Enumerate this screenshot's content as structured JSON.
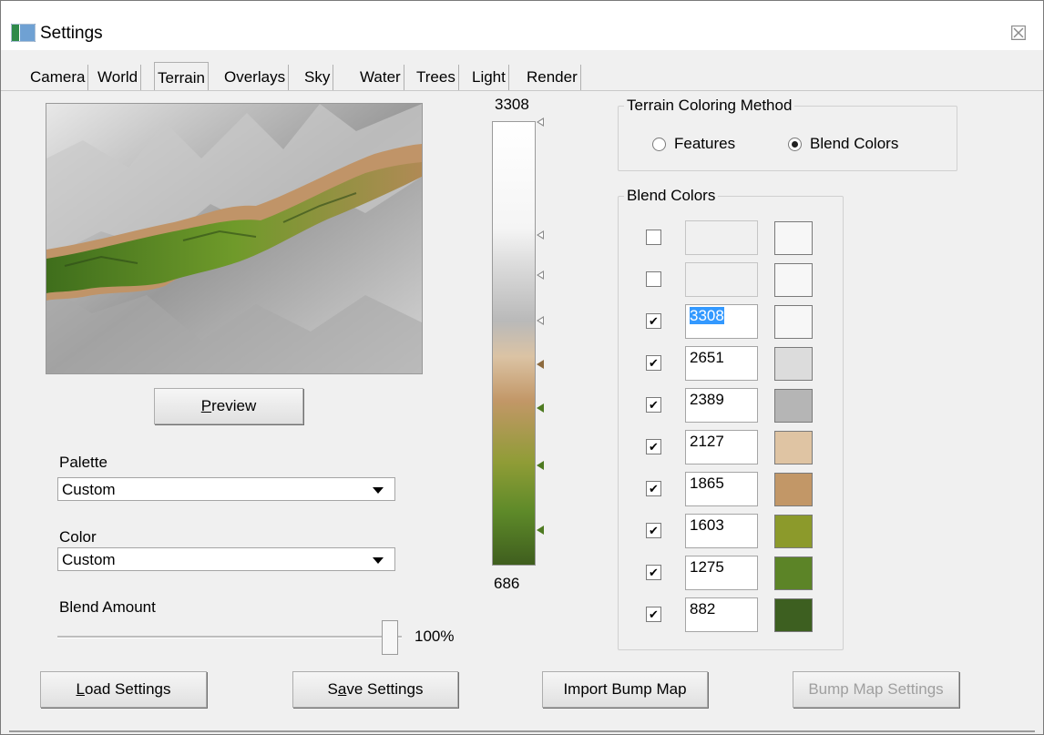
{
  "window": {
    "title": "Settings",
    "close_glyph": "☒"
  },
  "tabs": [
    {
      "label": "Camera"
    },
    {
      "label": "World"
    },
    {
      "label": "Terrain"
    },
    {
      "label": "Overlays"
    },
    {
      "label": "Sky"
    },
    {
      "label": "Water"
    },
    {
      "label": "Trees"
    },
    {
      "label": "Light"
    },
    {
      "label": "Render"
    }
  ],
  "active_tab": "Terrain",
  "preview": {
    "button_label": "Preview",
    "button_mnemonic": "P",
    "button_rest": "review"
  },
  "palette": {
    "label": "Palette",
    "value": "Custom"
  },
  "color": {
    "label": "Color",
    "value": "Custom"
  },
  "blend_amount": {
    "label": "Blend Amount",
    "value_text": "100%",
    "value": 100
  },
  "gradient": {
    "max": "3308",
    "min": "686"
  },
  "coloring_method": {
    "title": "Terrain Coloring Method",
    "options": [
      {
        "label": "Features",
        "checked": false
      },
      {
        "label": "Blend Colors",
        "checked": true
      }
    ]
  },
  "blend_colors": {
    "title": "Blend Colors",
    "rows": [
      {
        "checked": false,
        "value": "",
        "enabled": false,
        "color": "#f7f7f7"
      },
      {
        "checked": false,
        "value": "",
        "enabled": false,
        "color": "#f7f7f7"
      },
      {
        "checked": true,
        "value": "3308",
        "enabled": true,
        "selected": true,
        "color": "#f7f7f7"
      },
      {
        "checked": true,
        "value": "2651",
        "enabled": true,
        "color": "#dcdcdc"
      },
      {
        "checked": true,
        "value": "2389",
        "enabled": true,
        "color": "#b5b5b5"
      },
      {
        "checked": true,
        "value": "2127",
        "enabled": true,
        "color": "#dfc4a3"
      },
      {
        "checked": true,
        "value": "1865",
        "enabled": true,
        "color": "#c29767"
      },
      {
        "checked": true,
        "value": "1603",
        "enabled": true,
        "color": "#8c9a2b"
      },
      {
        "checked": true,
        "value": "1275",
        "enabled": true,
        "color": "#5c8427"
      },
      {
        "checked": true,
        "value": "882",
        "enabled": true,
        "color": "#3d5f20"
      }
    ]
  },
  "buttons": {
    "load": {
      "pre": "",
      "mn": "L",
      "post": "oad Settings"
    },
    "save": {
      "pre": "S",
      "mn": "a",
      "post": "ve Settings"
    },
    "import": {
      "label": "Import Bump Map"
    },
    "bump": {
      "label": "Bump Map Settings"
    }
  }
}
